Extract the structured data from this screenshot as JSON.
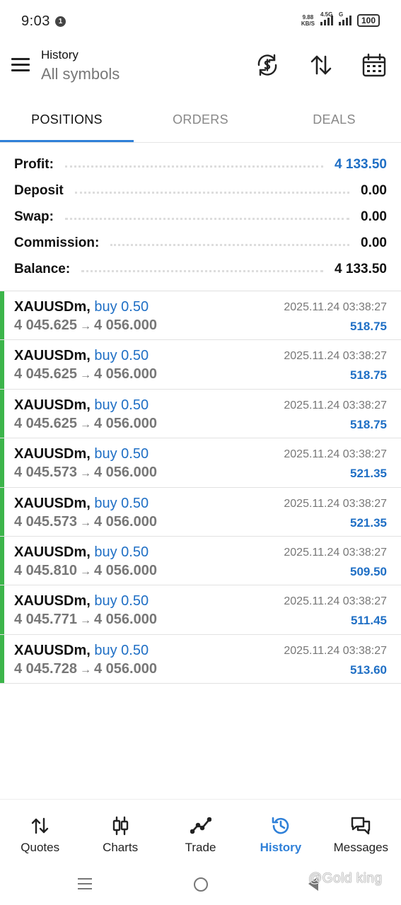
{
  "status_bar": {
    "time": "9:03",
    "notification_badge": "1",
    "net_speed_value": "9.88",
    "net_speed_unit": "KB/S",
    "signal1_label": "4.5G",
    "signal2_label": "G",
    "battery": "100"
  },
  "header": {
    "title": "History",
    "subtitle": "All symbols"
  },
  "tabs": [
    {
      "label": "POSITIONS",
      "active": true
    },
    {
      "label": "ORDERS",
      "active": false
    },
    {
      "label": "DEALS",
      "active": false
    }
  ],
  "summary": {
    "profit_label": "Profit:",
    "profit_value": "4 133.50",
    "deposit_label": "Deposit",
    "deposit_value": "0.00",
    "swap_label": "Swap:",
    "swap_value": "0.00",
    "commission_label": "Commission:",
    "commission_value": "0.00",
    "balance_label": "Balance:",
    "balance_value": "4 133.50"
  },
  "deals": [
    {
      "symbol": "XAUUSDm,",
      "side": "buy 0.50",
      "open": "4 045.625",
      "arrow": "→",
      "close": "4 056.000",
      "time": "2025.11.24 03:38:27",
      "profit": "518.75"
    },
    {
      "symbol": "XAUUSDm,",
      "side": "buy 0.50",
      "open": "4 045.625",
      "arrow": "→",
      "close": "4 056.000",
      "time": "2025.11.24 03:38:27",
      "profit": "518.75"
    },
    {
      "symbol": "XAUUSDm,",
      "side": "buy 0.50",
      "open": "4 045.625",
      "arrow": "→",
      "close": "4 056.000",
      "time": "2025.11.24 03:38:27",
      "profit": "518.75"
    },
    {
      "symbol": "XAUUSDm,",
      "side": "buy 0.50",
      "open": "4 045.573",
      "arrow": "→",
      "close": "4 056.000",
      "time": "2025.11.24 03:38:27",
      "profit": "521.35"
    },
    {
      "symbol": "XAUUSDm,",
      "side": "buy 0.50",
      "open": "4 045.573",
      "arrow": "→",
      "close": "4 056.000",
      "time": "2025.11.24 03:38:27",
      "profit": "521.35"
    },
    {
      "symbol": "XAUUSDm,",
      "side": "buy 0.50",
      "open": "4 045.810",
      "arrow": "→",
      "close": "4 056.000",
      "time": "2025.11.24 03:38:27",
      "profit": "509.50"
    },
    {
      "symbol": "XAUUSDm,",
      "side": "buy 0.50",
      "open": "4 045.771",
      "arrow": "→",
      "close": "4 056.000",
      "time": "2025.11.24 03:38:27",
      "profit": "511.45"
    },
    {
      "symbol": "XAUUSDm,",
      "side": "buy 0.50",
      "open": "4 045.728",
      "arrow": "→",
      "close": "4 056.000",
      "time": "2025.11.24 03:38:27",
      "profit": "513.60"
    }
  ],
  "bottom_nav": [
    {
      "label": "Quotes",
      "icon": "quotes-icon",
      "active": false
    },
    {
      "label": "Charts",
      "icon": "charts-icon",
      "active": false
    },
    {
      "label": "Trade",
      "icon": "trade-icon",
      "active": false
    },
    {
      "label": "History",
      "icon": "history-icon",
      "active": true
    },
    {
      "label": "Messages",
      "icon": "messages-icon",
      "active": false
    }
  ],
  "watermark": "@Gold king",
  "colors": {
    "accent": "#2f80d8",
    "value_blue": "#1f6fc5",
    "buy_bar": "#3cb54a",
    "muted_text": "#777777"
  }
}
